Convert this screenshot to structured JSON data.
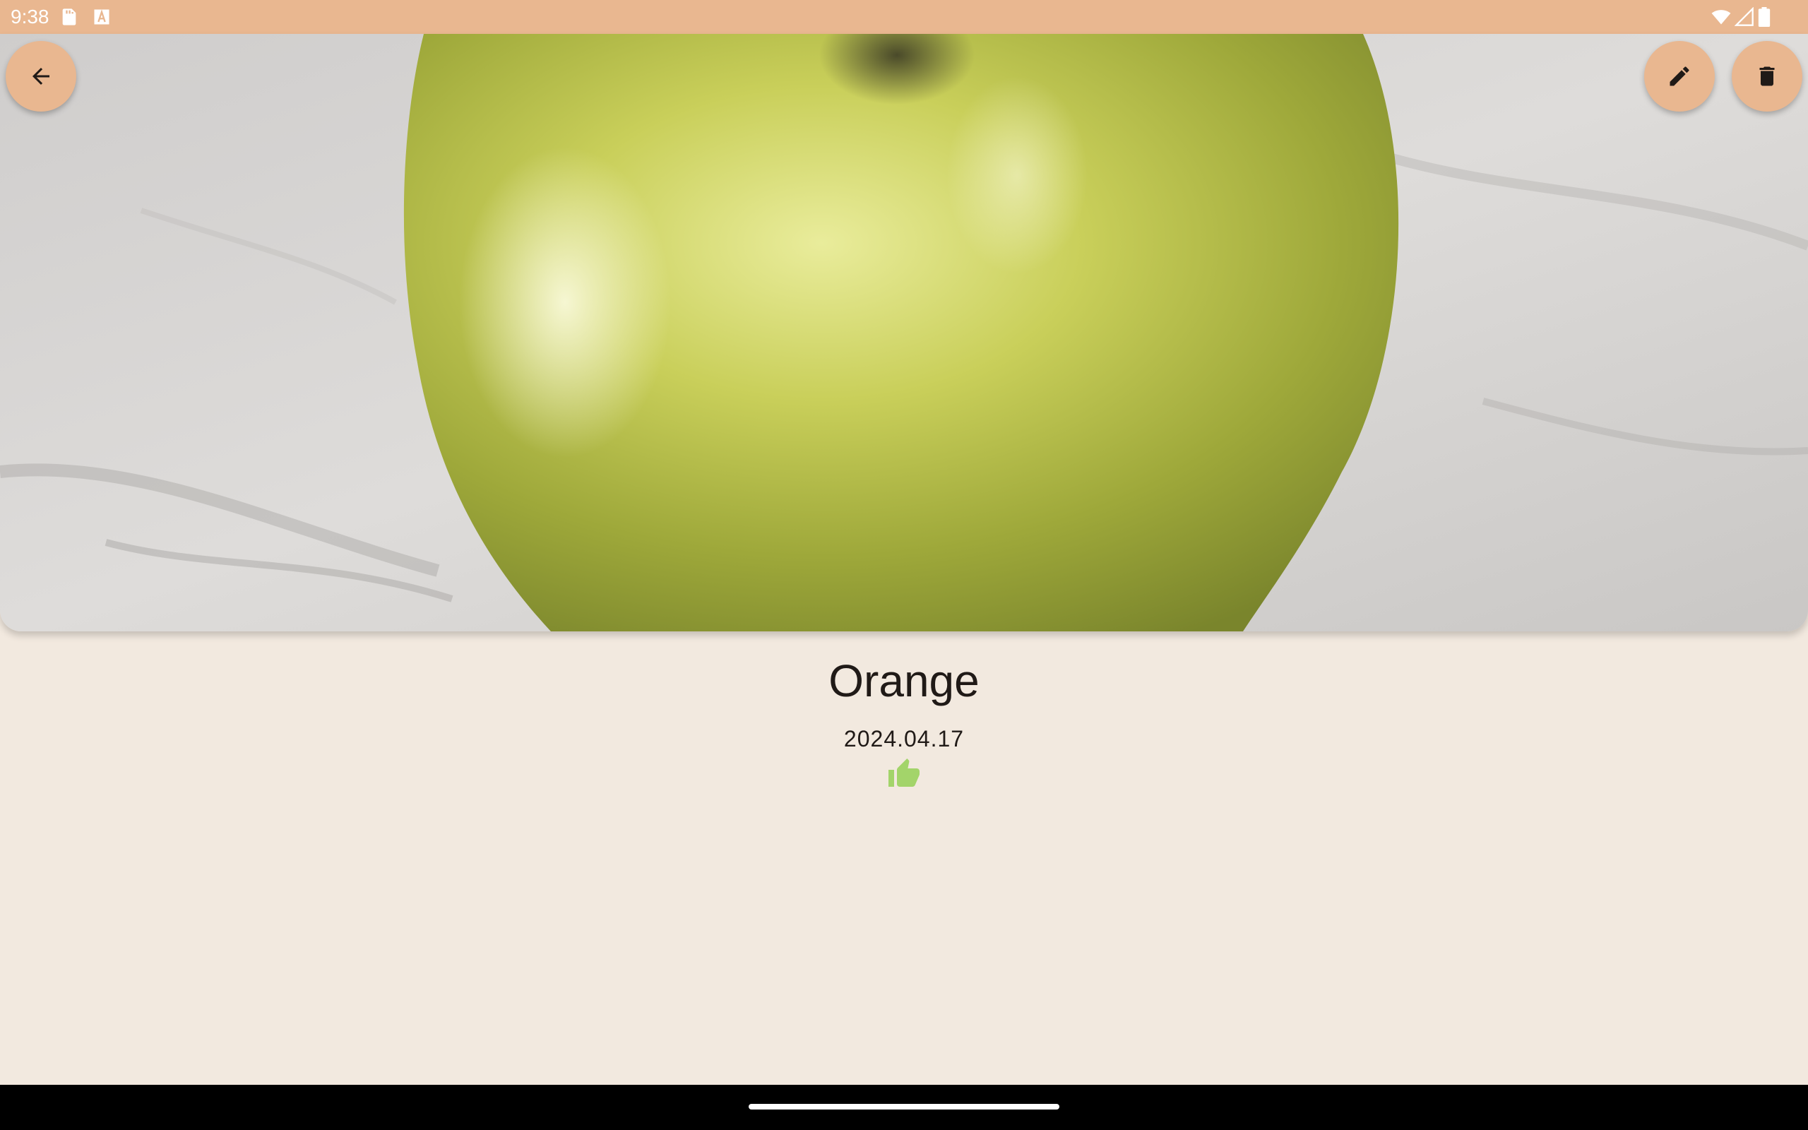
{
  "status_bar": {
    "time": "9:38",
    "left_icons": [
      "sd-card-icon",
      "text-a-icon"
    ],
    "right_icons": [
      "wifi-icon",
      "signal-icon",
      "battery-icon"
    ],
    "color": "#e9b790"
  },
  "toolbar": {
    "back_icon": "arrow-back-icon",
    "edit_icon": "pencil-icon",
    "delete_icon": "trash-icon",
    "button_color": "#e9b790"
  },
  "item": {
    "photo": "green-apple-photo",
    "title": "Orange",
    "date": "2024.04.17",
    "rating_icon": "thumb-up-icon",
    "rating_color": "#a3d46a"
  },
  "colors": {
    "background": "#f2e9df",
    "text": "#201a17"
  }
}
